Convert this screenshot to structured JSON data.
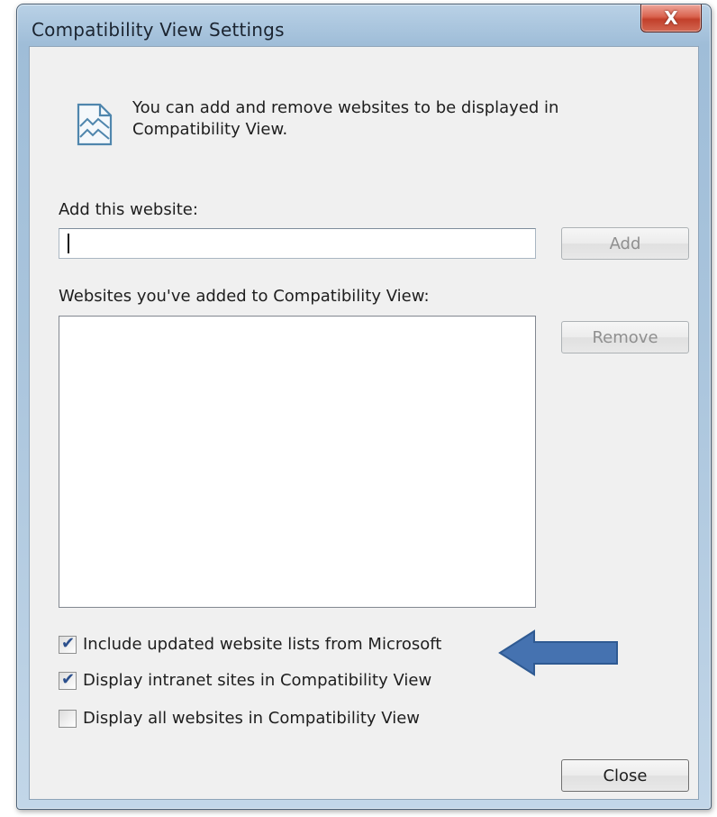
{
  "window": {
    "title": "Compatibility View Settings",
    "close_glyph": "X"
  },
  "info": {
    "icon": "compatibility-view-icon",
    "text": "You can add and remove websites to be displayed in Compatibility View."
  },
  "add_section": {
    "label": "Add this website:",
    "input_value": "",
    "add_button_label": "Add",
    "add_enabled": false
  },
  "list_section": {
    "label": "Websites you've added to Compatibility View:",
    "items": [],
    "remove_button_label": "Remove",
    "remove_enabled": false
  },
  "options": [
    {
      "label": "Include updated website lists from Microsoft",
      "checked": true
    },
    {
      "label": "Display intranet sites in Compatibility View",
      "checked": true
    },
    {
      "label": "Display all websites in Compatibility View",
      "checked": false
    }
  ],
  "annotation": {
    "arrow_color": "#4572b0",
    "points_to": "Include updated website lists from Microsoft"
  },
  "footer": {
    "close_button_label": "Close"
  }
}
